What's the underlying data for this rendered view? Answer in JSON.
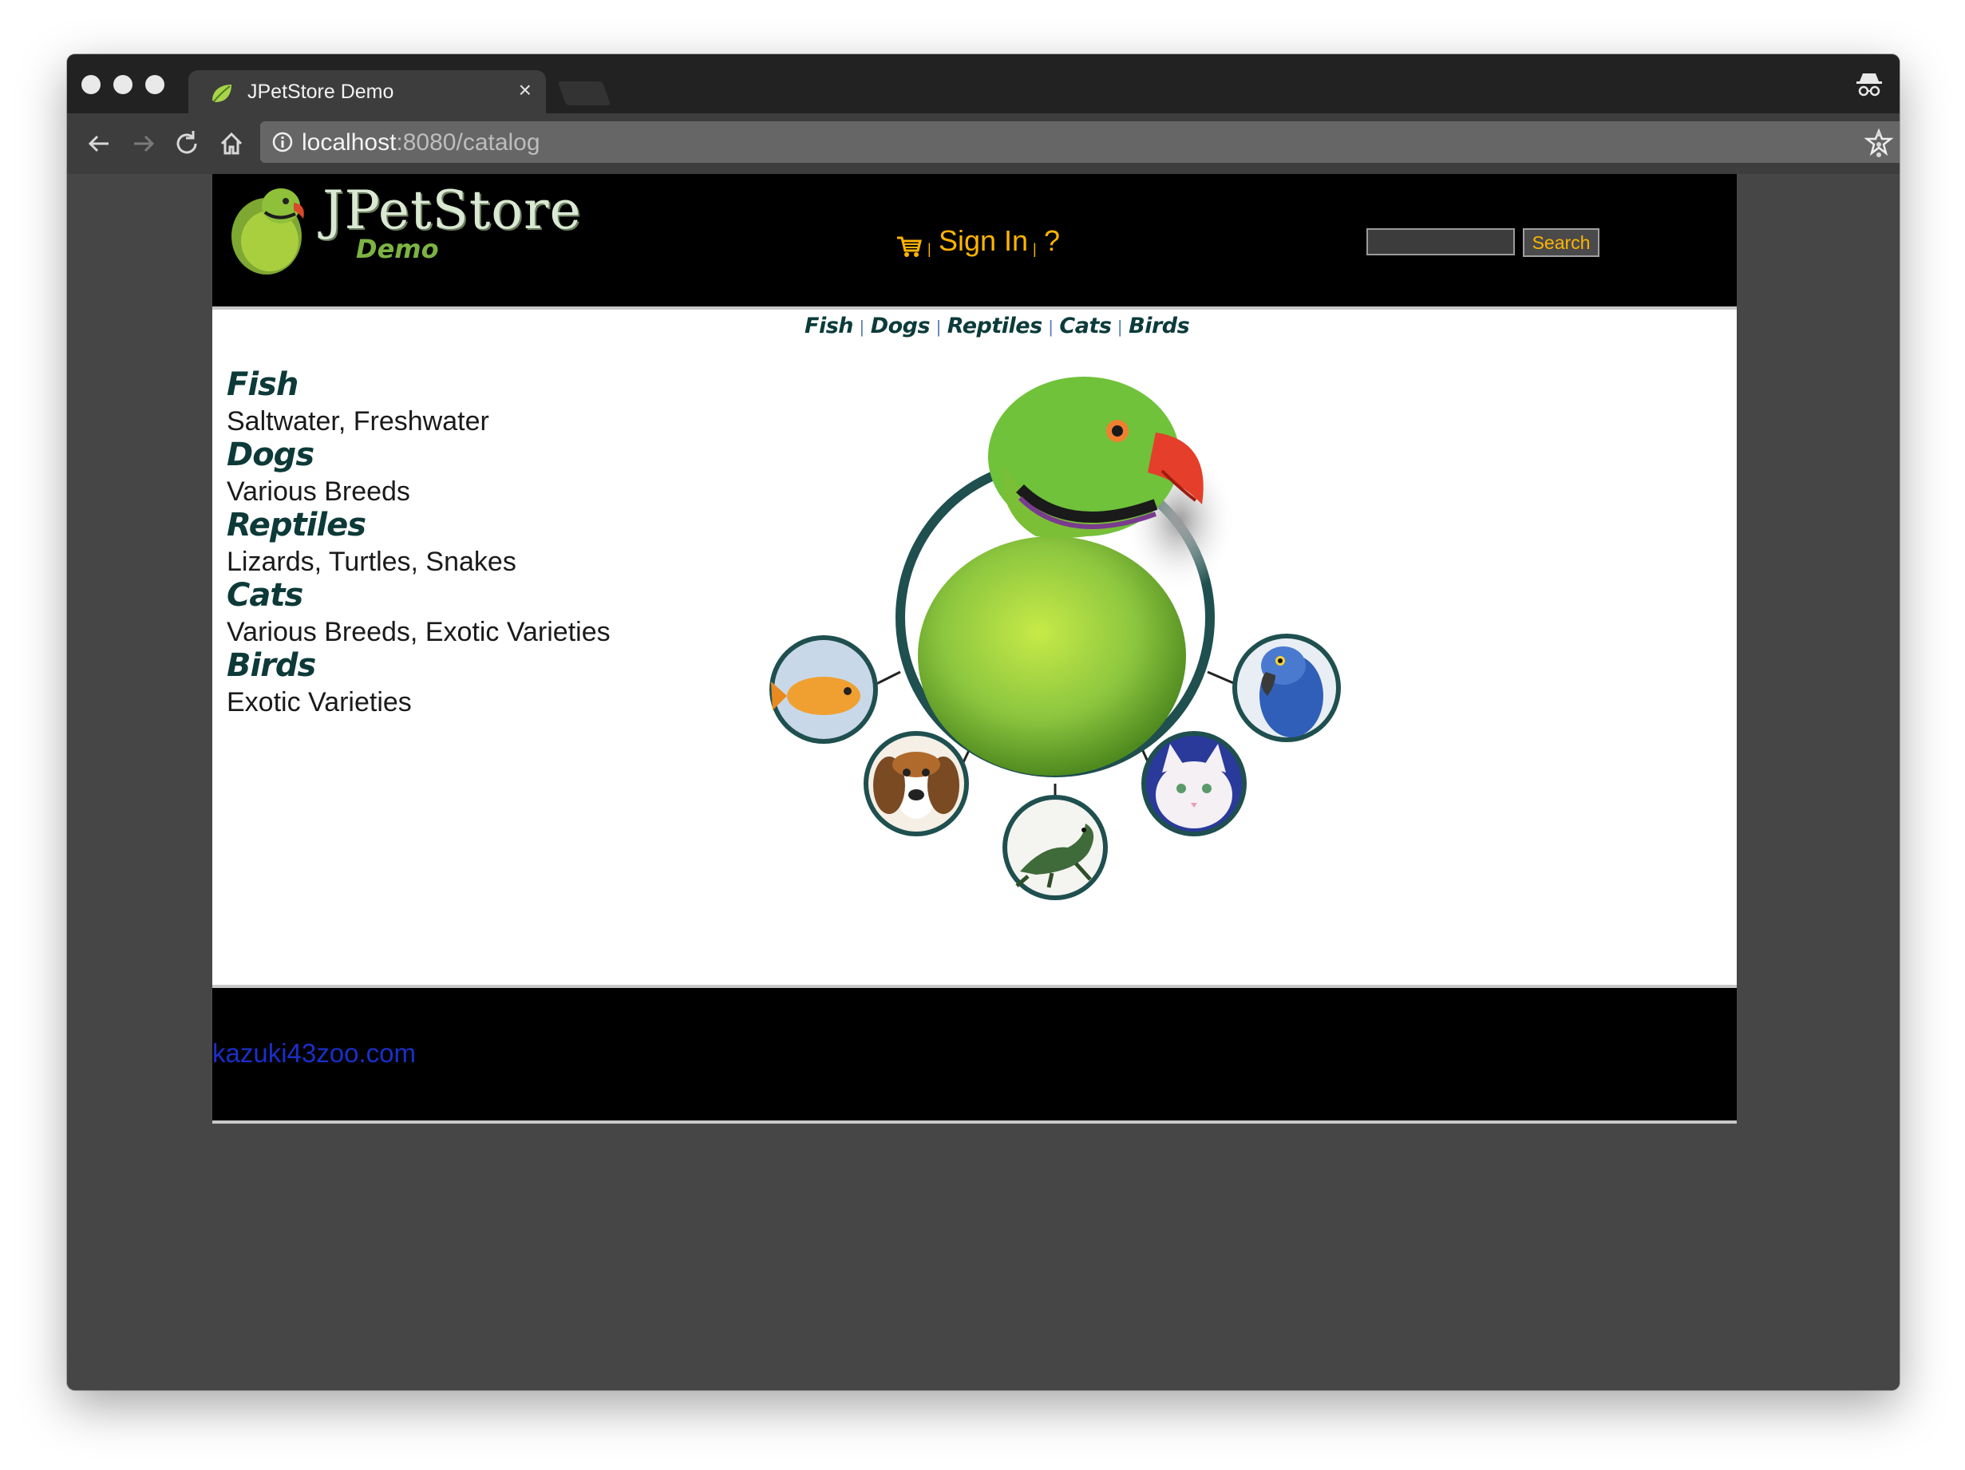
{
  "browser": {
    "tab_title": "JPetStore Demo",
    "tab_close": "×",
    "url_host": "localhost",
    "url_path": ":8080/catalog"
  },
  "header": {
    "logo_title": "JPetStore",
    "logo_subtitle": "Demo",
    "sign_in": "Sign In",
    "help": "?",
    "pipe": "|",
    "search_value": "",
    "search_button": "Search"
  },
  "quicklinks": [
    {
      "label": "Fish"
    },
    {
      "label": "Dogs"
    },
    {
      "label": "Reptiles"
    },
    {
      "label": "Cats"
    },
    {
      "label": "Birds"
    }
  ],
  "quicklink_separator": "|",
  "categories": [
    {
      "name": "Fish",
      "description": "Saltwater, Freshwater"
    },
    {
      "name": "Dogs",
      "description": "Various Breeds"
    },
    {
      "name": "Reptiles",
      "description": "Lizards, Turtles, Snakes"
    },
    {
      "name": "Cats",
      "description": "Various Breeds, Exotic Varieties"
    },
    {
      "name": "Birds",
      "description": "Exotic Varieties"
    }
  ],
  "footer": {
    "link": "kazuki43zoo.com"
  },
  "colors": {
    "accent": "#ffb400",
    "category_text": "#0d3a38",
    "footer_link": "#1a2fc9"
  }
}
